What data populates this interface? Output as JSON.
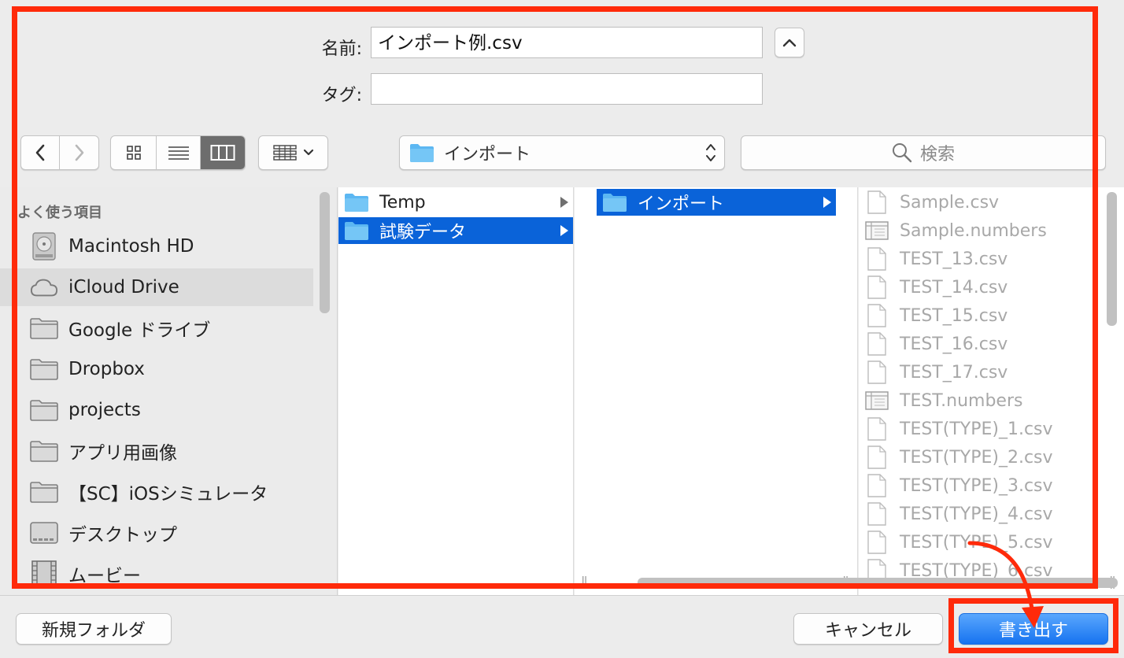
{
  "save_panel": {
    "name_label": "名前:",
    "name_value": "インポート例.csv",
    "tags_label": "タグ:",
    "tags_value": ""
  },
  "toolbar": {
    "location": "インポート",
    "search_placeholder": "検索"
  },
  "sidebar": {
    "section_title": "よく使う項目",
    "items": [
      {
        "label": "Macintosh HD",
        "icon": "hard-drive-icon"
      },
      {
        "label": "iCloud Drive",
        "icon": "cloud-icon"
      },
      {
        "label": "Google ドライブ",
        "icon": "folder-icon"
      },
      {
        "label": "Dropbox",
        "icon": "folder-icon"
      },
      {
        "label": "projects",
        "icon": "folder-icon"
      },
      {
        "label": "アプリ用画像",
        "icon": "folder-icon"
      },
      {
        "label": "【SC】iOSシミュレータ",
        "icon": "folder-icon"
      },
      {
        "label": "デスクトップ",
        "icon": "desktop-icon"
      },
      {
        "label": "ムービー",
        "icon": "film-icon"
      }
    ]
  },
  "columns": {
    "col1": [
      {
        "label": "Temp",
        "selected": false
      },
      {
        "label": "試験データ",
        "selected": true
      }
    ],
    "col2": [
      {
        "label": "インポート",
        "selected": true
      }
    ],
    "files": [
      {
        "label": "Sample.csv",
        "icon": "csv-file-icon"
      },
      {
        "label": "Sample.numbers",
        "icon": "numbers-file-icon"
      },
      {
        "label": "TEST_13.csv",
        "icon": "csv-file-icon"
      },
      {
        "label": "TEST_14.csv",
        "icon": "csv-file-icon"
      },
      {
        "label": "TEST_15.csv",
        "icon": "csv-file-icon"
      },
      {
        "label": "TEST_16.csv",
        "icon": "csv-file-icon"
      },
      {
        "label": "TEST_17.csv",
        "icon": "csv-file-icon"
      },
      {
        "label": "TEST.numbers",
        "icon": "numbers-file-icon"
      },
      {
        "label": "TEST(TYPE)_1.csv",
        "icon": "csv-file-icon"
      },
      {
        "label": "TEST(TYPE)_2.csv",
        "icon": "csv-file-icon"
      },
      {
        "label": "TEST(TYPE)_3.csv",
        "icon": "csv-file-icon"
      },
      {
        "label": "TEST(TYPE)_4.csv",
        "icon": "csv-file-icon"
      },
      {
        "label": "TEST(TYPE)_5.csv",
        "icon": "csv-file-icon"
      },
      {
        "label": "TEST(TYPE)_6.csv",
        "icon": "csv-file-icon"
      }
    ]
  },
  "buttons": {
    "new_folder": "新規フォルダ",
    "cancel": "キャンセル",
    "export": "書き出す"
  },
  "colors": {
    "selection": "#0a63d9",
    "annotation": "#ff2a0a",
    "folder": "#5cb7f2"
  }
}
